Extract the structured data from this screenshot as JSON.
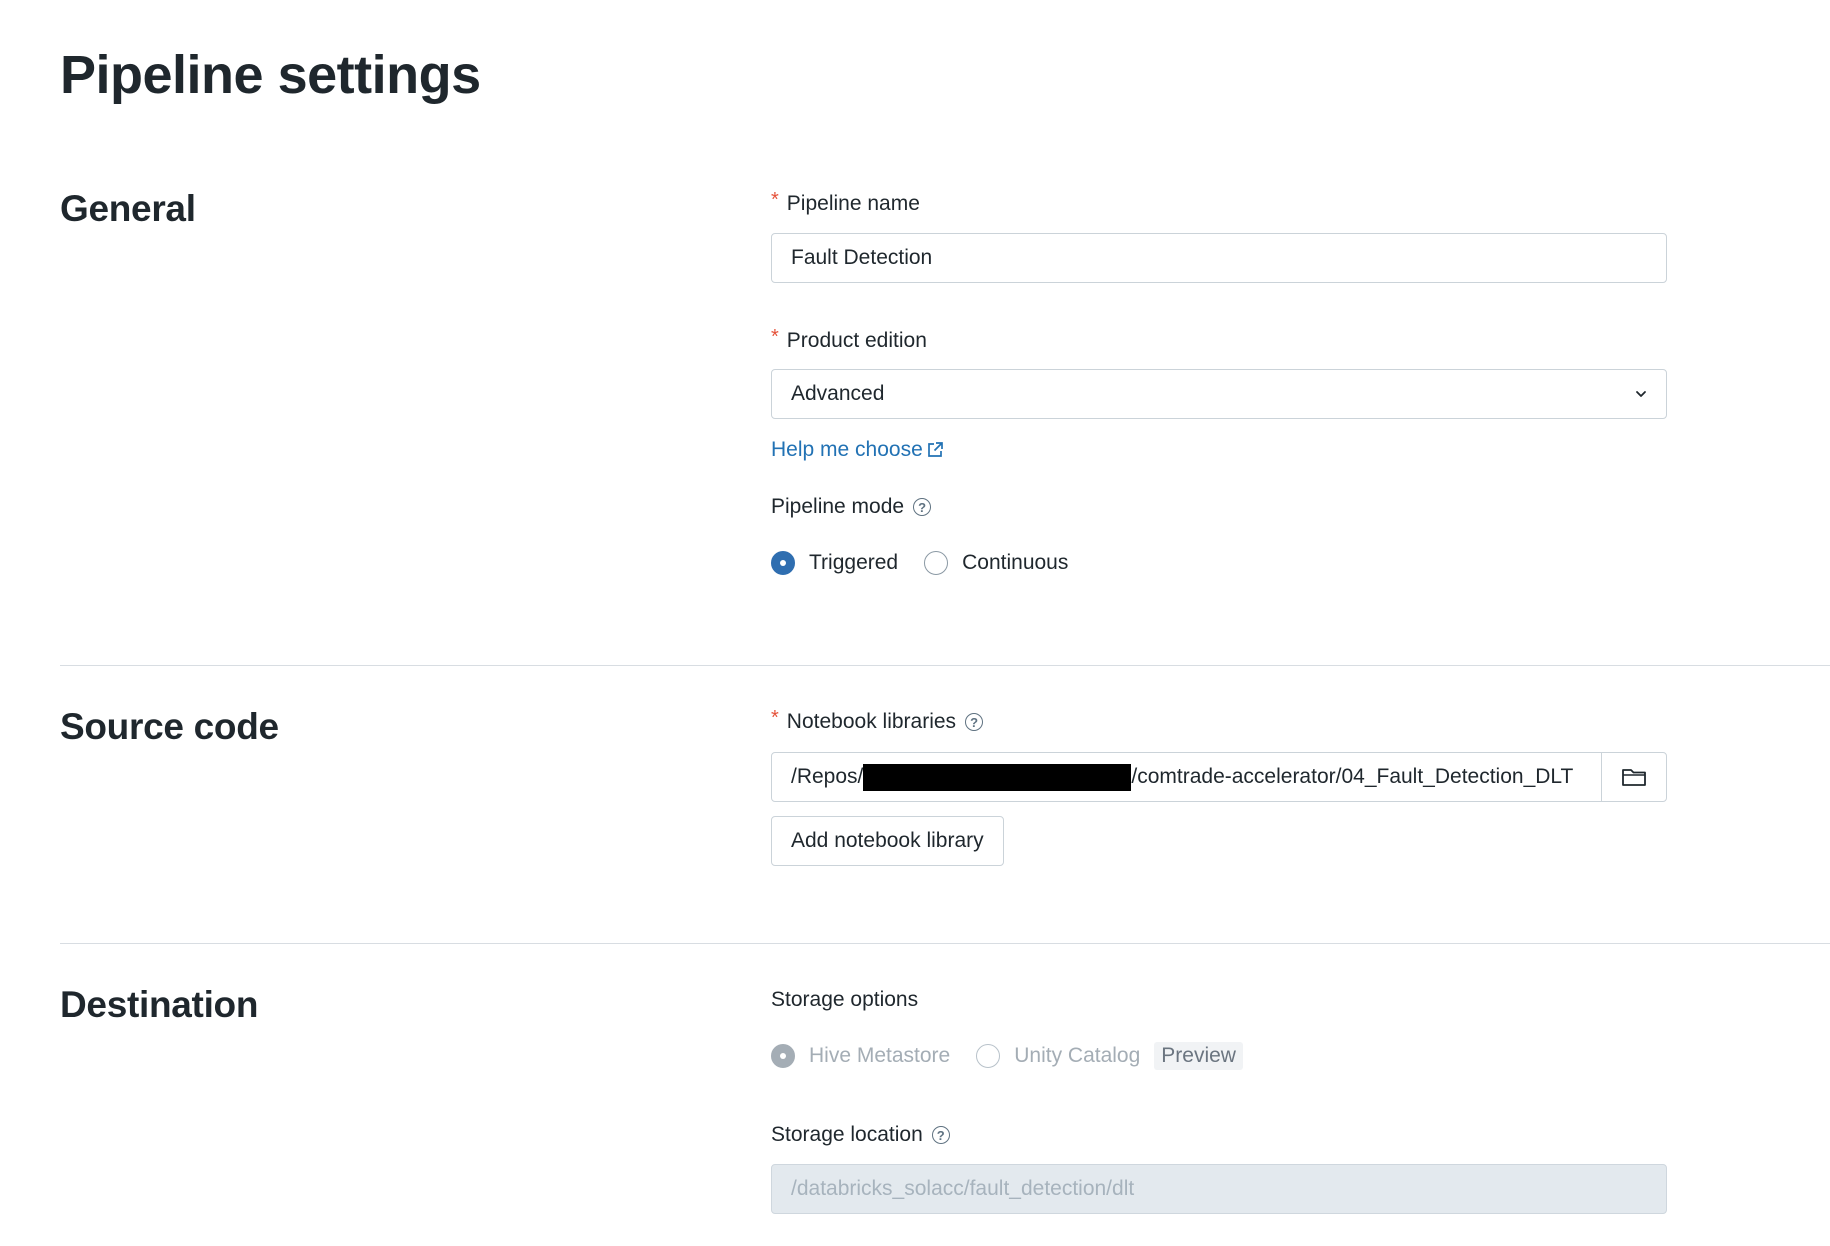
{
  "page": {
    "title": "Pipeline settings"
  },
  "general": {
    "section_title": "General",
    "pipeline_name": {
      "label": "Pipeline name",
      "required": "*",
      "value": "Fault Detection"
    },
    "product_edition": {
      "label": "Product edition",
      "required": "*",
      "value": "Advanced"
    },
    "help_link": "Help me choose",
    "pipeline_mode": {
      "label": "Pipeline mode",
      "options": [
        {
          "label": "Triggered",
          "selected": true
        },
        {
          "label": "Continuous",
          "selected": false
        }
      ]
    }
  },
  "source_code": {
    "section_title": "Source code",
    "notebook_libraries": {
      "label": "Notebook libraries",
      "required": "*",
      "path_prefix": "/Repos/",
      "path_suffix": "/comtrade-accelerator/04_Fault_Detection_DLT"
    },
    "add_button": "Add notebook library"
  },
  "destination": {
    "section_title": "Destination",
    "storage_options": {
      "label": "Storage options",
      "options": [
        {
          "label": "Hive Metastore",
          "selected": true,
          "disabled": true
        },
        {
          "label": "Unity Catalog",
          "selected": false,
          "disabled": true,
          "badge": "Preview"
        }
      ]
    },
    "storage_location": {
      "label": "Storage location",
      "placeholder": "/databricks_solacc/fault_detection/dlt"
    }
  },
  "colors": {
    "accent": "#2f6eb0",
    "link": "#2272b4",
    "required": "#e5523a",
    "text": "#1f272d"
  }
}
